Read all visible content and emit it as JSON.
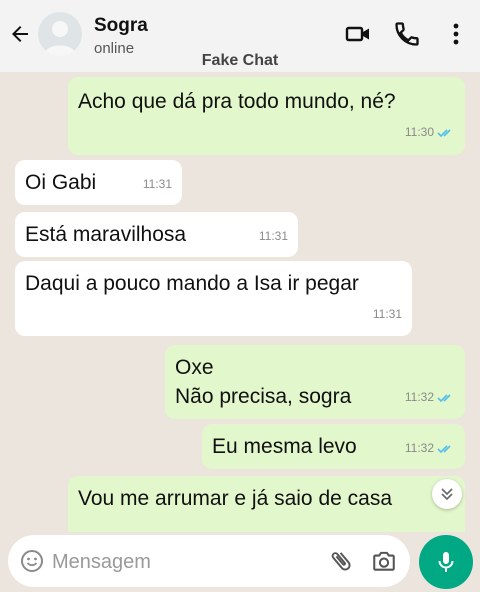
{
  "header": {
    "contact_name": "Sogra",
    "contact_status": "online",
    "watermark": "Fake Chat"
  },
  "icons": {
    "back": "back-arrow-icon",
    "video": "video-call-icon",
    "call": "phone-icon",
    "menu": "more-vert-icon",
    "emoji": "emoji-icon",
    "attach": "paperclip-icon",
    "camera": "camera-icon",
    "mic": "mic-icon",
    "scroll": "chevron-down-double-icon"
  },
  "messages": [
    {
      "direction": "out",
      "lines": [
        "Acho que dá pra todo mundo, né?"
      ],
      "time": "11:30",
      "status": "read"
    },
    {
      "direction": "in",
      "lines": [
        "Oi Gabi"
      ],
      "time": "11:31"
    },
    {
      "direction": "in",
      "lines": [
        "Está maravilhosa"
      ],
      "time": "11:31"
    },
    {
      "direction": "in",
      "lines": [
        "Daqui a pouco mando a Isa ir pegar"
      ],
      "time": "11:31"
    },
    {
      "direction": "out",
      "lines": [
        "Oxe",
        "Não precisa, sogra"
      ],
      "time": "11:32",
      "status": "read"
    },
    {
      "direction": "out",
      "lines": [
        "Eu mesma levo"
      ],
      "time": "11:32",
      "status": "read"
    },
    {
      "direction": "out",
      "lines": [
        "Vou me arrumar e já saio de casa"
      ],
      "time": "",
      "status": ""
    }
  ],
  "composer": {
    "placeholder": "Mensagem"
  },
  "colors": {
    "outgoing_bubble": "#e2f7cb",
    "incoming_bubble": "#ffffff",
    "accent": "#00a884",
    "read_tick": "#53bdeb",
    "background": "#ece5dd"
  }
}
